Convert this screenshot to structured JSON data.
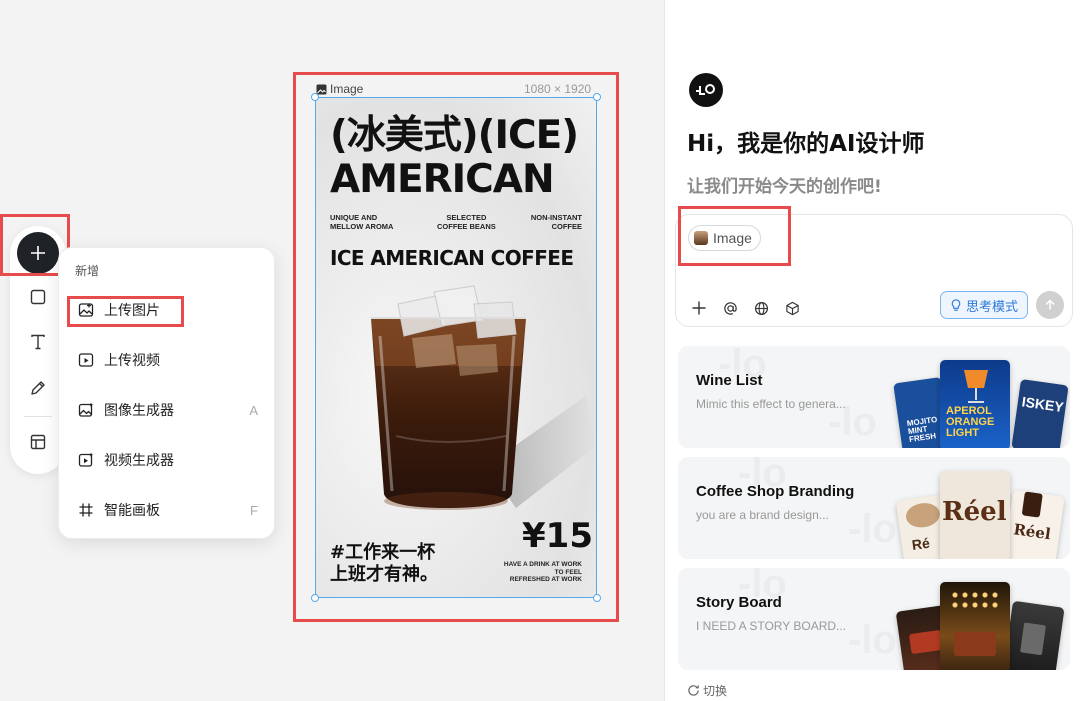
{
  "toolbar": {
    "items": [
      "plus",
      "rectangle",
      "text",
      "pen",
      "layout"
    ]
  },
  "menu": {
    "title": "新增",
    "items": [
      {
        "label": "上传图片",
        "shortcut": ""
      },
      {
        "label": "上传视频",
        "shortcut": ""
      },
      {
        "label": "图像生成器",
        "shortcut": "A"
      },
      {
        "label": "视频生成器",
        "shortcut": ""
      },
      {
        "label": "智能画板",
        "shortcut": "F"
      }
    ]
  },
  "frame": {
    "label": "Image",
    "size": "1080 × 1920"
  },
  "poster": {
    "title_line1": "(冰美式)(ICE)",
    "title_line2": "AMERICAN",
    "sub_left": "UNIQUE AND\nMELLOW AROMA",
    "sub_mid": "SELECTED\nCOFFEE BEANS",
    "sub_right": "NON-INSTANT\nCOFFEE",
    "headline": "ICE AMERICAN COFFEE",
    "cn_slogan": "#工作来一杯\n上班才有神。",
    "price": "¥15",
    "tagline": "HAVE A DRINK AT WORK\nTO FEEL\nREFRESHED AT WORK"
  },
  "panel": {
    "greeting": "Hi，我是你的AI设计师",
    "subgreeting": "让我们开始今天的创作吧!",
    "chip_label": "Image",
    "think_label": "思考模式",
    "switch_label": "切换",
    "cards": [
      {
        "title": "Wine List",
        "desc": "Mimic this effect to genera..."
      },
      {
        "title": "Coffee Shop Branding",
        "desc": "you are a brand design..."
      },
      {
        "title": "Story Board",
        "desc": "I NEED A STORY BOARD..."
      }
    ],
    "thumb_texts": {
      "wine_1": "MOJITO\nMINT\nFRESH",
      "wine_2": "APEROL\nORANGE\nLIGHT",
      "wine_3": "ISKEY",
      "coffee_1": "Ré",
      "coffee_2": "Réel",
      "coffee_3": "Réel"
    }
  },
  "colors": {
    "accent_blue": "#2e7bd6",
    "highlight_red": "#e84b4b",
    "selection_blue": "#58a8e8"
  }
}
